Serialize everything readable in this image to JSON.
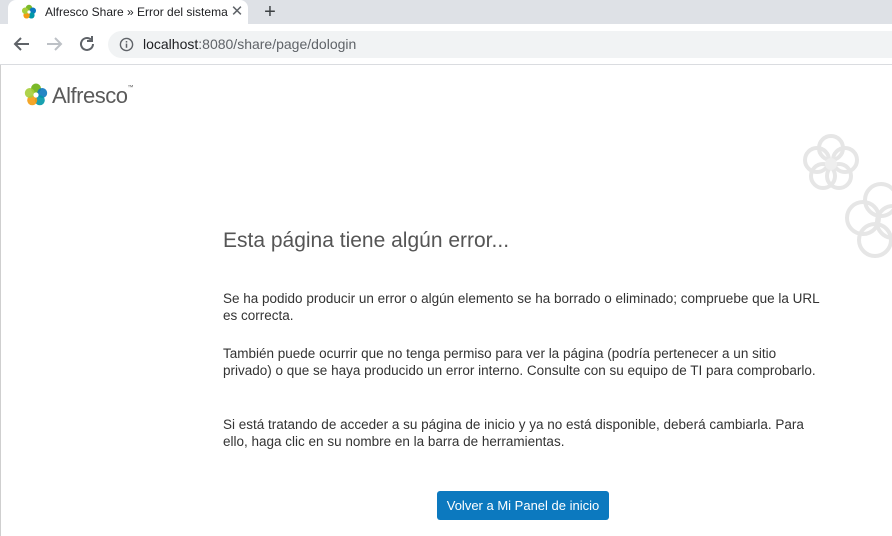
{
  "browser": {
    "tab_title": "Alfresco Share » Error del sistema",
    "close_label": "✕",
    "new_tab_label": "+",
    "url_host": "localhost",
    "url_rest": ":8080/share/page/dologin"
  },
  "page": {
    "logo_text": "Alfresco",
    "logo_tm": "™",
    "error_title": "Esta página tiene algún error...",
    "paragraphs": [
      "Se ha podido producir un error o algún elemento se ha borrado o eliminado; compruebe que la URL es correcta.",
      "También puede ocurrir que no tenga permiso para ver la página (podría pertenecer a un sitio privado) o que se haya producido un error interno. Consulte con su equipo de TI para comprobarlo.",
      "Si está tratando de acceder a su página de inicio y ya no está disponible, deberá cambiarla. Para ello, haga clic en su nombre en la barra de herramientas."
    ],
    "home_button_label": "Volver a Mi Panel de inicio"
  },
  "colors": {
    "button": "#0c79bf",
    "logo_green": "#7ab929",
    "logo_blue": "#0c79bf",
    "logo_orange": "#f39c12"
  },
  "icons": [
    "alfresco-logo-icon",
    "back-arrow-icon",
    "forward-arrow-icon",
    "reload-icon",
    "info-icon",
    "close-icon",
    "plus-icon"
  ]
}
